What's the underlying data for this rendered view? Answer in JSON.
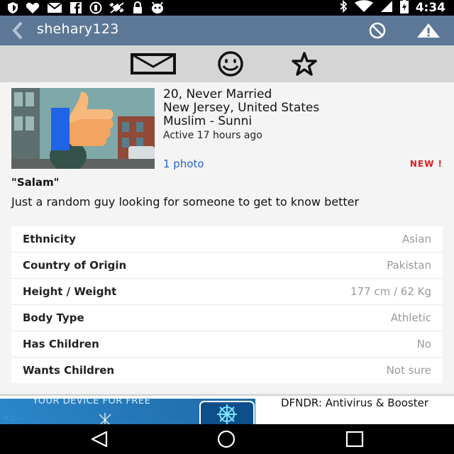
{
  "status_bar": {
    "time": "4:34",
    "left_icons": [
      "shield-icon",
      "heart-icon",
      "mail-icon",
      "facebook-icon",
      "circle-icon",
      "satellite-off-icon",
      "lock-icon",
      "bug-icon"
    ],
    "right_icons": [
      "bluetooth-icon",
      "wifi-icon",
      "signal-icon",
      "battery-icon"
    ]
  },
  "app_bar": {
    "username": "shehary123",
    "actions": [
      "block-icon",
      "warning-icon"
    ]
  },
  "action_strip": {
    "actions": [
      "message-icon",
      "smiley-icon",
      "favorite-star-icon"
    ]
  },
  "profile": {
    "summary_line1": "20, Never Married",
    "location": "New Jersey, United States",
    "religion": "Muslim - Sunni",
    "activity": "Active 17 hours ago",
    "photos_link": "1 photo",
    "new_badge": "NEW !",
    "headline": "\"Salam\"",
    "about": "Just a random guy looking for someone to get to know better"
  },
  "details": [
    {
      "label": "Ethnicity",
      "value": "Asian"
    },
    {
      "label": "Country of Origin",
      "value": "Pakistan"
    },
    {
      "label": "Height / Weight",
      "value": "177 cm / 62 Kg"
    },
    {
      "label": "Body Type",
      "value": "Athletic"
    },
    {
      "label": "Has Children",
      "value": "No"
    },
    {
      "label": "Wants Children",
      "value": "Not sure"
    }
  ],
  "ad": {
    "partial_text": "YOUR DEVICE FOR FREE",
    "title": "DFNDR: Antivirus & Booster"
  },
  "nav_bar": {
    "buttons": [
      "back-triangle-icon",
      "home-circle-icon",
      "recents-square-icon"
    ]
  },
  "colors": {
    "app_bar": "#5d7896",
    "link": "#2a63c4",
    "new_badge": "#e01b1b"
  }
}
